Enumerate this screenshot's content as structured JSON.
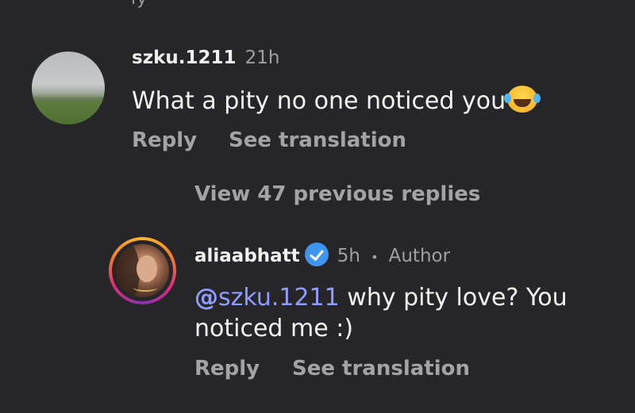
{
  "top_cut_text": "ly",
  "comments": [
    {
      "username": "szku.1211",
      "time": "21h",
      "text": "What a pity no one noticed you",
      "emoji": "face-with-tears-of-joy-icon",
      "reply_label": "Reply",
      "translate_label": "See translation"
    }
  ],
  "thread": {
    "view_previous_label": "View 47 previous replies"
  },
  "reply": {
    "username": "aliaabhatt",
    "verified": true,
    "time": "5h",
    "separator": "•",
    "badge": "Author",
    "mention": "szku.1211",
    "text_line1": "why pity love? You",
    "text_line2": "noticed me :)",
    "reply_label": "Reply",
    "translate_label": "See translation"
  },
  "colors": {
    "background": "#262628",
    "mention": "#8f9cff",
    "verified": "#3d95f0",
    "muted": "#a3a3a7"
  }
}
